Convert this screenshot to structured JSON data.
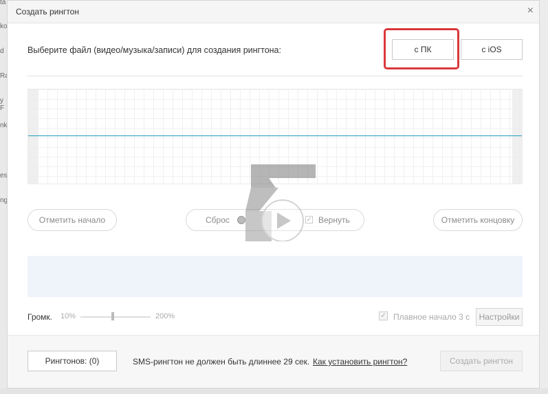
{
  "background": {
    "left_fragments": [
      "ta",
      "ko",
      "d",
      "Ra",
      "y F",
      "nk",
      "es",
      "ng"
    ]
  },
  "dialog": {
    "title": "Создать рингтон",
    "close_glyph": "×",
    "prompt": "Выберите файл (видео/музыка/записи) для создания рингтона:",
    "source_pc": "с ПК",
    "source_ios": "с iOS",
    "highlight_color": "#d9383b",
    "waveform_color": "#1f9bbd",
    "mark_start": "Отметить начало",
    "reset": "Сброс",
    "restore": "Вернуть",
    "mark_end": "Отметить концовку",
    "volume_label": "Громк.",
    "volume_min": "10%",
    "volume_max": "200%",
    "fade_in": "Плавное начало 3 с",
    "settings": "Настройки",
    "ringtones": "Рингтонов: (0)",
    "sms_note": "SMS-рингтон не должен быть длиннее 29 сек.",
    "how_to_link": "Как установить рингтон?",
    "create": "Создать рингтон"
  }
}
